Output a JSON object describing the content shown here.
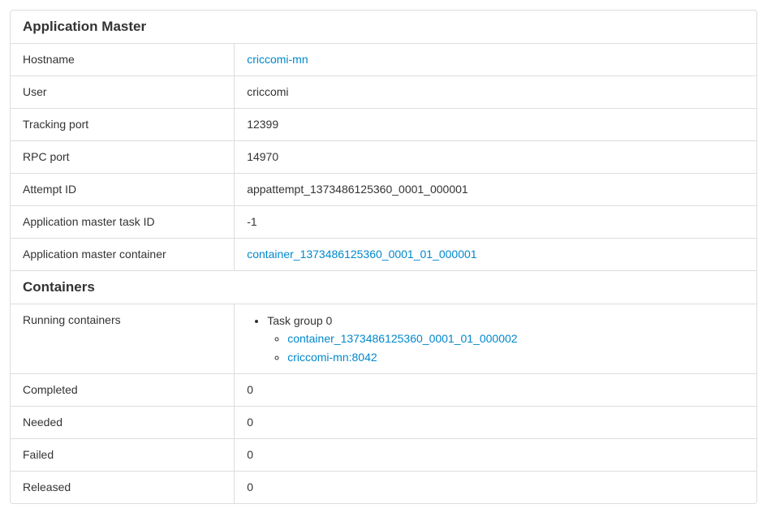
{
  "application_master": {
    "heading": "Application Master",
    "rows": {
      "hostname_label": "Hostname",
      "hostname_value": "criccomi-mn",
      "user_label": "User",
      "user_value": "criccomi",
      "tracking_port_label": "Tracking port",
      "tracking_port_value": "12399",
      "rpc_port_label": "RPC port",
      "rpc_port_value": "14970",
      "attempt_id_label": "Attempt ID",
      "attempt_id_value": "appattempt_1373486125360_0001_000001",
      "am_task_id_label": "Application master task ID",
      "am_task_id_value": "-1",
      "am_container_label": "Application master container",
      "am_container_value": "container_1373486125360_0001_01_000001"
    }
  },
  "containers": {
    "heading": "Containers",
    "running_label": "Running containers",
    "task_group_label": "Task group 0",
    "task_group_container": "container_1373486125360_0001_01_000002",
    "task_group_host": "criccomi-mn:8042",
    "completed_label": "Completed",
    "completed_value": "0",
    "needed_label": "Needed",
    "needed_value": "0",
    "failed_label": "Failed",
    "failed_value": "0",
    "released_label": "Released",
    "released_value": "0"
  }
}
